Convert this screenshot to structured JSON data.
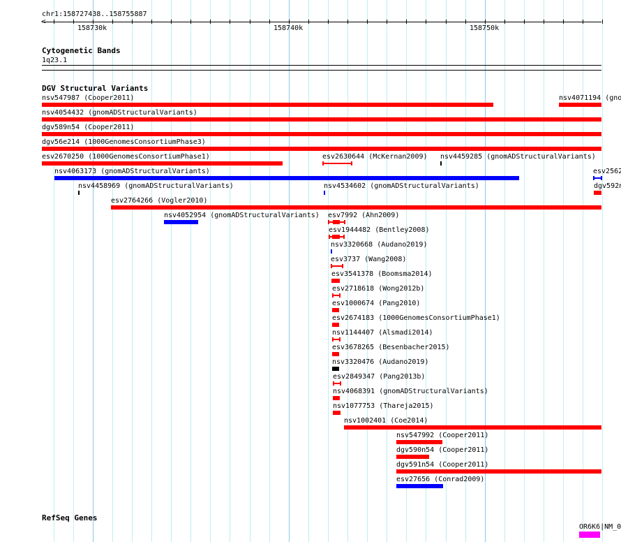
{
  "ruler": {
    "locus": "chr1:158727438..158755887",
    "ticks": [
      "158730k",
      "158740k",
      "158750k"
    ]
  },
  "tracks": {
    "cytobands": {
      "title": "Cytogenetic Bands",
      "band": "1q23.1"
    },
    "dgv": {
      "title": "DGV Structural Variants",
      "features": [
        {
          "label": "nsv547987 (Cooper2011)",
          "color": "#ff0000",
          "style": "bar"
        },
        {
          "label": "nsv4071194 (gno",
          "color": "#ff0000",
          "style": "bar"
        },
        {
          "label": "nsv4054432 (gnomADStructuralVariants)",
          "color": "#ff0000",
          "style": "bar"
        },
        {
          "label": "dgv589n54 (Cooper2011)",
          "color": "#ff0000",
          "style": "bar"
        },
        {
          "label": "dgv56e214 (1000GenomesConsortiumPhase3)",
          "color": "#ff0000",
          "style": "bar"
        },
        {
          "label": "esv2670250 (1000GenomesConsortiumPhase1)",
          "color": "#ff0000",
          "style": "bar"
        },
        {
          "label": "esv2630644 (McKernan2009)",
          "color": "#ff0000",
          "style": "capped-line"
        },
        {
          "label": "nsv4459285 (gnomADStructuralVariants)",
          "color": "#000000",
          "style": "bar"
        },
        {
          "label": "nsv4063173 (gnomADStructuralVariants)",
          "color": "#0000ff",
          "style": "bar"
        },
        {
          "label": "esv2562",
          "color": "#0000ff",
          "style": "capped-line"
        },
        {
          "label": "nsv4458969 (gnomADStructuralVariants)",
          "color": "#000000",
          "style": "bar"
        },
        {
          "label": "nsv4534602 (gnomADStructuralVariants)",
          "color": "#0000ff",
          "style": "bar"
        },
        {
          "label": "dgv592n",
          "color": "#ff0000",
          "style": "bar"
        },
        {
          "label": "esv2764266 (Vogler2010)",
          "color": "#ff0000",
          "style": "bar"
        },
        {
          "label": "nsv4052954 (gnomADStructuralVariants)",
          "color": "#0000ff",
          "style": "bar"
        },
        {
          "label": "esv7992 (Ahn2009)",
          "color": "#ff0000",
          "style": "capped-core"
        },
        {
          "label": "esv1944482 (Bentley2008)",
          "color": "#ff0000",
          "style": "capped-core"
        },
        {
          "label": "nsv3320668 (Audano2019)",
          "color": "#0000ff",
          "style": "bar"
        },
        {
          "label": "esv3737 (Wang2008)",
          "color": "#ff0000",
          "style": "capped-line"
        },
        {
          "label": "esv3541378 (Boomsma2014)",
          "color": "#ff0000",
          "style": "bar"
        },
        {
          "label": "esv2718618 (Wong2012b)",
          "color": "#ff0000",
          "style": "capped-line"
        },
        {
          "label": "esv1000674 (Pang2010)",
          "color": "#ff0000",
          "style": "bar"
        },
        {
          "label": "esv2674183 (1000GenomesConsortiumPhase1)",
          "color": "#ff0000",
          "style": "bar"
        },
        {
          "label": "nsv1144407 (Alsmadi2014)",
          "color": "#ff0000",
          "style": "capped-line"
        },
        {
          "label": "esv3678265 (Besenbacher2015)",
          "color": "#ff0000",
          "style": "bar"
        },
        {
          "label": "nsv3320476 (Audano2019)",
          "color": "#000000",
          "style": "bar"
        },
        {
          "label": "esv2849347 (Pang2013b)",
          "color": "#ff0000",
          "style": "capped-line"
        },
        {
          "label": "nsv4068391 (gnomADStructuralVariants)",
          "color": "#ff0000",
          "style": "bar"
        },
        {
          "label": "nsv1077753 (Thareja2015)",
          "color": "#ff0000",
          "style": "bar"
        },
        {
          "label": "nsv1002401 (Coe2014)",
          "color": "#ff0000",
          "style": "bar"
        },
        {
          "label": "nsv547992 (Cooper2011)",
          "color": "#ff0000",
          "style": "bar"
        },
        {
          "label": "dgv590n54 (Cooper2011)",
          "color": "#ff0000",
          "style": "bar"
        },
        {
          "label": "dgv591n54 (Cooper2011)",
          "color": "#ff0000",
          "style": "bar"
        },
        {
          "label": "esv27656 (Conrad2009)",
          "color": "#0000ff",
          "style": "bar"
        }
      ]
    },
    "refseq": {
      "title": "RefSeq Genes",
      "features": [
        {
          "label": "OR6K6|NM_0",
          "color": "#ff00ff",
          "style": "bar"
        }
      ]
    }
  }
}
